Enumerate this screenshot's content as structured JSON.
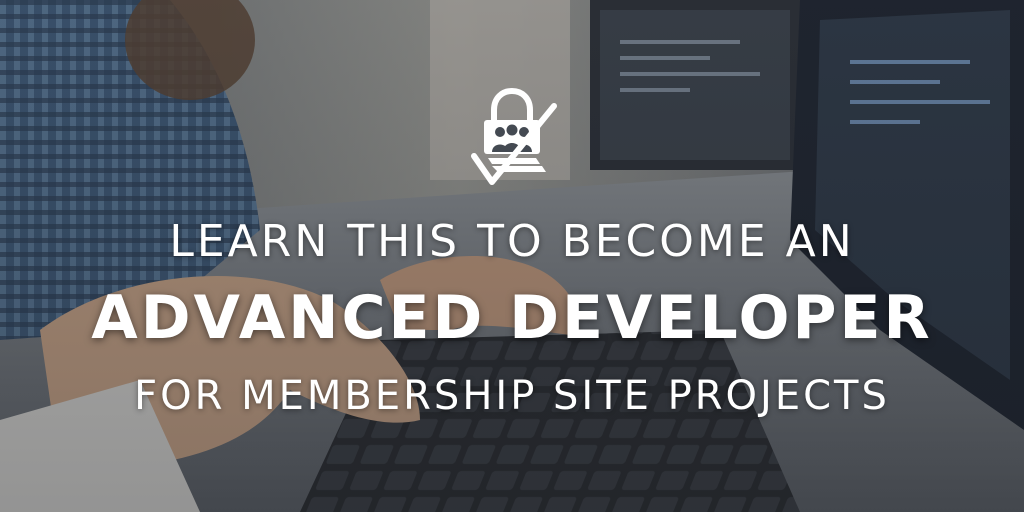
{
  "headline": {
    "line1": "LEARN THIS TO BECOME AN",
    "line2": "ADVANCED DEVELOPER",
    "line3": "FOR MEMBERSHIP SITE PROJECTS"
  },
  "logo": {
    "icon": "membership-lock-icon",
    "color": "#ffffff"
  },
  "colors": {
    "text": "#ffffff",
    "overlay": "#2a2f38"
  }
}
